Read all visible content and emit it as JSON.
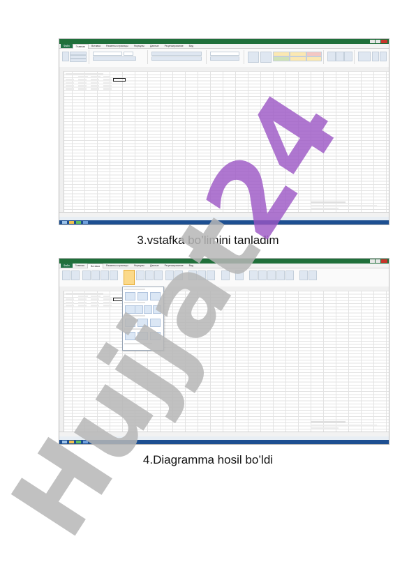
{
  "captions": {
    "first": "3.vstafka bo’limini tanladim",
    "second": "4.Diagramma hosil bo’ldi"
  },
  "watermark": {
    "text": "Hujjat24",
    "color": "#b6b6b6",
    "accent": "#9b55c4"
  },
  "screenshots": {
    "colors": {
      "titlebar": "#1f6f3a",
      "file_tab": "#217346",
      "taskbar": "#1d4f91"
    },
    "tabs_first": [
      "Файл",
      "Главная",
      "Вставка",
      "Разметка страницы",
      "Формулы",
      "Данные",
      "Рецензирование",
      "Вид"
    ],
    "tabs_second": [
      "Файл",
      "Главная",
      "Вставка",
      "Разметка страницы",
      "Формулы",
      "Данные",
      "Рецензирование",
      "Вид"
    ]
  }
}
